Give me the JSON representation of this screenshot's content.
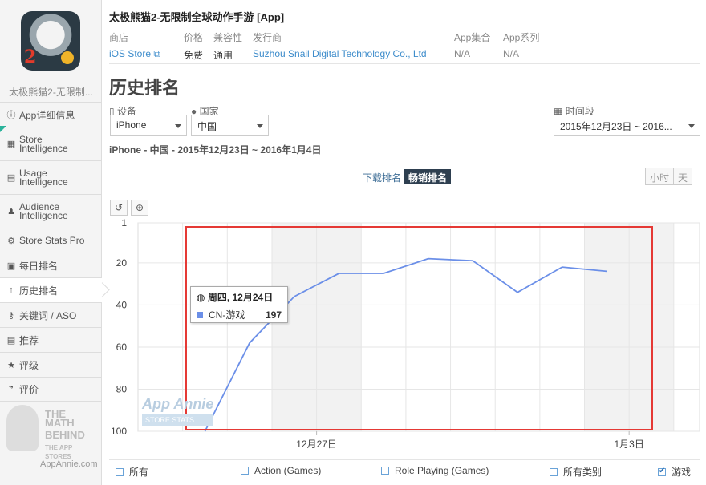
{
  "sidebar": {
    "app_name": "太极熊猫2-无限制...",
    "icon_number": "2",
    "items": [
      {
        "label": "App详细信息",
        "icon": "info-circle-icon"
      },
      {
        "label": "Store\nIntelligence",
        "icon": "store-icon"
      },
      {
        "label": "Usage\nIntelligence",
        "icon": "usage-icon"
      },
      {
        "label": "Audience\nIntelligence",
        "icon": "person-icon"
      },
      {
        "label": "Store Stats Pro",
        "icon": "gear-icon"
      },
      {
        "label": "每日排名",
        "icon": "calendar-icon"
      },
      {
        "label": "历史排名",
        "icon": "arrow-up-icon"
      },
      {
        "label": "关键词 / ASO",
        "icon": "key-icon"
      },
      {
        "label": "推荐",
        "icon": "bookmark-icon"
      },
      {
        "label": "评级",
        "icon": "star-icon"
      },
      {
        "label": "评价",
        "icon": "comments-icon"
      }
    ],
    "promo": {
      "line1": "THE MATH",
      "line2": "BEHIND",
      "line3": "THE APP STORES",
      "url": "AppAnnie.com"
    }
  },
  "header": {
    "title": "太极熊猫2-无限制全球动作手游 [App]",
    "meta": [
      {
        "label": "商店",
        "value": "iOS Store"
      },
      {
        "label": "价格",
        "value": "免费"
      },
      {
        "label": "兼容性",
        "value": "通用"
      },
      {
        "label": "发行商",
        "value": "Suzhou Snail Digital Technology Co., Ltd"
      },
      {
        "label": "App集合",
        "value": "N/A"
      },
      {
        "label": "App系列",
        "value": "N/A"
      }
    ]
  },
  "page_title": "历史排名",
  "filters": {
    "device": {
      "label": "设备",
      "value": "iPhone"
    },
    "country": {
      "label": "国家",
      "value": "中国"
    },
    "period": {
      "label": "时间段",
      "value": "2015年12月23日 ~ 2016..."
    }
  },
  "subheading": "iPhone - 中国 - 2015年12月23日 ~ 2016年1月4日",
  "tabs": {
    "download": "下载排名",
    "grossing": "畅销排名"
  },
  "granularity": {
    "hour": "小时",
    "day": "天"
  },
  "watermark": {
    "line1": "App Annie",
    "line2": "STORE STATS"
  },
  "tooltip": {
    "date": "周四, 12月24日",
    "series": "CN-游戏",
    "value": "197"
  },
  "legend": [
    {
      "label": "所有",
      "checked": false
    },
    {
      "label": "Action (Games)",
      "checked": false
    },
    {
      "label": "Role Playing (Games)",
      "checked": false
    },
    {
      "label": "所有类别",
      "checked": false
    },
    {
      "label": "游戏",
      "checked": true
    }
  ],
  "colors": {
    "series": "#6b8fe8",
    "highlight_box": "#e53935",
    "link": "#3d8ccb",
    "active_tab": "#2e3f50"
  },
  "chart_data": {
    "type": "line",
    "x": [
      "12月23日",
      "12月24日",
      "12月25日",
      "12月26日",
      "12月27日",
      "12月28日",
      "12月29日",
      "12月30日",
      "12月31日",
      "1月1日",
      "1月2日",
      "1月3日",
      "1月4日"
    ],
    "series": [
      {
        "name": "CN-游戏",
        "values": [
          null,
          197,
          58,
          36,
          25,
          25,
          18,
          19,
          34,
          22,
          24,
          null,
          null
        ]
      }
    ],
    "ylim": [
      1,
      100
    ],
    "y_reversed": true,
    "yticks": [
      "1",
      "20",
      "40",
      "60",
      "80",
      "100"
    ],
    "xticks": [
      "12月27日",
      "1月3日"
    ]
  }
}
